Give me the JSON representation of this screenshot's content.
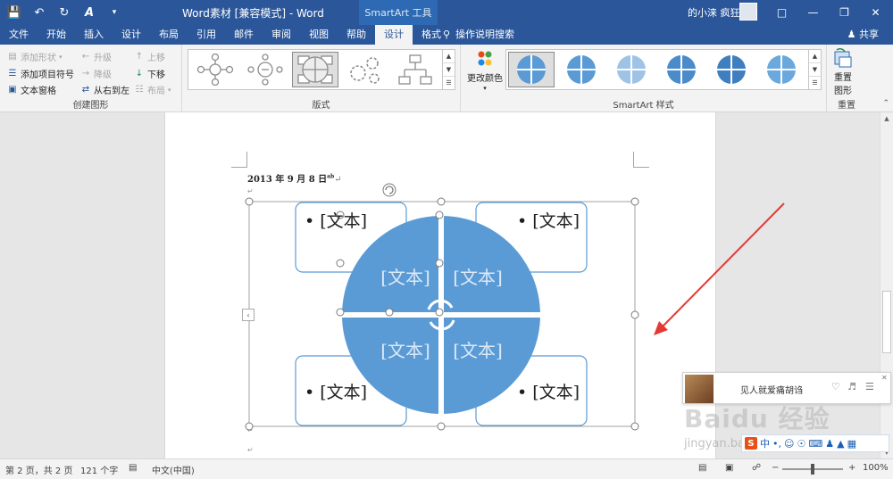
{
  "titlebar": {
    "doc_title": "Word素材 [兼容模式]  -  Word",
    "context_tools": "SmartArt 工具",
    "user_name": "的小涞 疯狂",
    "qat": [
      "save-icon",
      "undo-icon",
      "redo-icon",
      "format-icon",
      "customize-icon"
    ]
  },
  "tabs": [
    "文件",
    "开始",
    "插入",
    "设计",
    "布局",
    "引用",
    "邮件",
    "审阅",
    "视图",
    "帮助",
    "设计",
    "格式"
  ],
  "active_tab_index": 10,
  "search_label": "操作说明搜索",
  "share_label": "共享",
  "ribbon": {
    "create_group": {
      "label": "创建图形",
      "add_shape": "添加形状",
      "add_bullet": "添加项目符号",
      "text_pane": "文本窗格",
      "promote": "升级",
      "demote": "降级",
      "right_to_left": "从右到左",
      "move_up": "上移",
      "move_down": "下移",
      "layout": "布局"
    },
    "layouts_group": {
      "label": "版式"
    },
    "styles_group": {
      "label": "SmartArt 样式",
      "change_colors": "更改颜色"
    },
    "reset_group": {
      "label": "重置",
      "reset_graphic_line1": "重置",
      "reset_graphic_line2": "图形"
    }
  },
  "document": {
    "date_text": "2013 年 9 月 8 日",
    "date_suffix": "ab",
    "placeholder": "[文本]",
    "bullet_placeholder": "• [文本]"
  },
  "status": {
    "page": "第 2 页，共 2 页",
    "words": "121 个字",
    "language": "中文(中国)",
    "zoom": "100%",
    "zoom_fraction": 0.5
  },
  "music": {
    "song": "见人就爱痛胡诌"
  },
  "watermark": {
    "brand": "Baidu 经验",
    "url": "jingyan.baidu.com"
  },
  "ime": {
    "mode": "中"
  },
  "colors": {
    "title_blue": "#2b579a",
    "smartart_blue": "#5b9bd5",
    "box_border": "#5b9bd5",
    "arrow_red": "#e53935"
  }
}
